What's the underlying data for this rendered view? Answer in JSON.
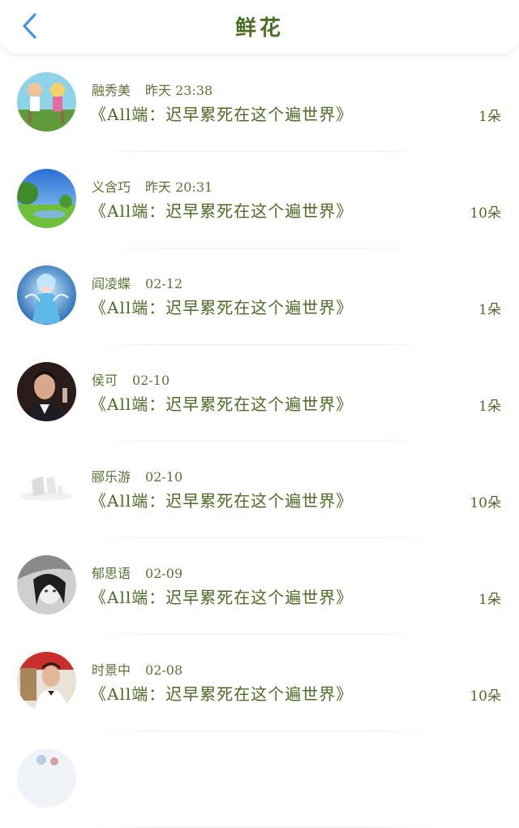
{
  "header": {
    "title": "鲜花",
    "back_icon": "chevron-left-icon",
    "back_color": "#4a90e2"
  },
  "items": [
    {
      "name": "融秀美",
      "date": "昨天 23:38",
      "title": "《All端：迟早累死在这个遍世界》",
      "count": "1朵",
      "avatar_icon": "cartoon-kids-avatar"
    },
    {
      "name": "义含巧",
      "date": "昨天 20:31",
      "title": "《All端：迟早累死在这个遍世界》",
      "count": "10朵",
      "avatar_icon": "landscape-avatar"
    },
    {
      "name": "阎凌蝶",
      "date": "02-12",
      "title": "《All端：迟早累死在这个遍世界》",
      "count": "1朵",
      "avatar_icon": "fairy-avatar"
    },
    {
      "name": "侯可",
      "date": "02-10",
      "title": "《All端：迟早累死在这个遍世界》",
      "count": "1朵",
      "avatar_icon": "man-portrait-avatar"
    },
    {
      "name": "郦乐游",
      "date": "02-10",
      "title": "《All端：迟早累死在这个遍世界》",
      "count": "10朵",
      "avatar_icon": "faded-logo-avatar"
    },
    {
      "name": "郁思语",
      "date": "02-09",
      "title": "《All端：迟早累死在这个遍世界》",
      "count": "1朵",
      "avatar_icon": "bw-girl-avatar"
    },
    {
      "name": "时景中",
      "date": "02-08",
      "title": "《All端：迟早累死在这个遍世界》",
      "count": "10朵",
      "avatar_icon": "chef-avatar"
    }
  ],
  "colors": {
    "accent_text": "#4e6a25",
    "background": "#ffffff"
  }
}
